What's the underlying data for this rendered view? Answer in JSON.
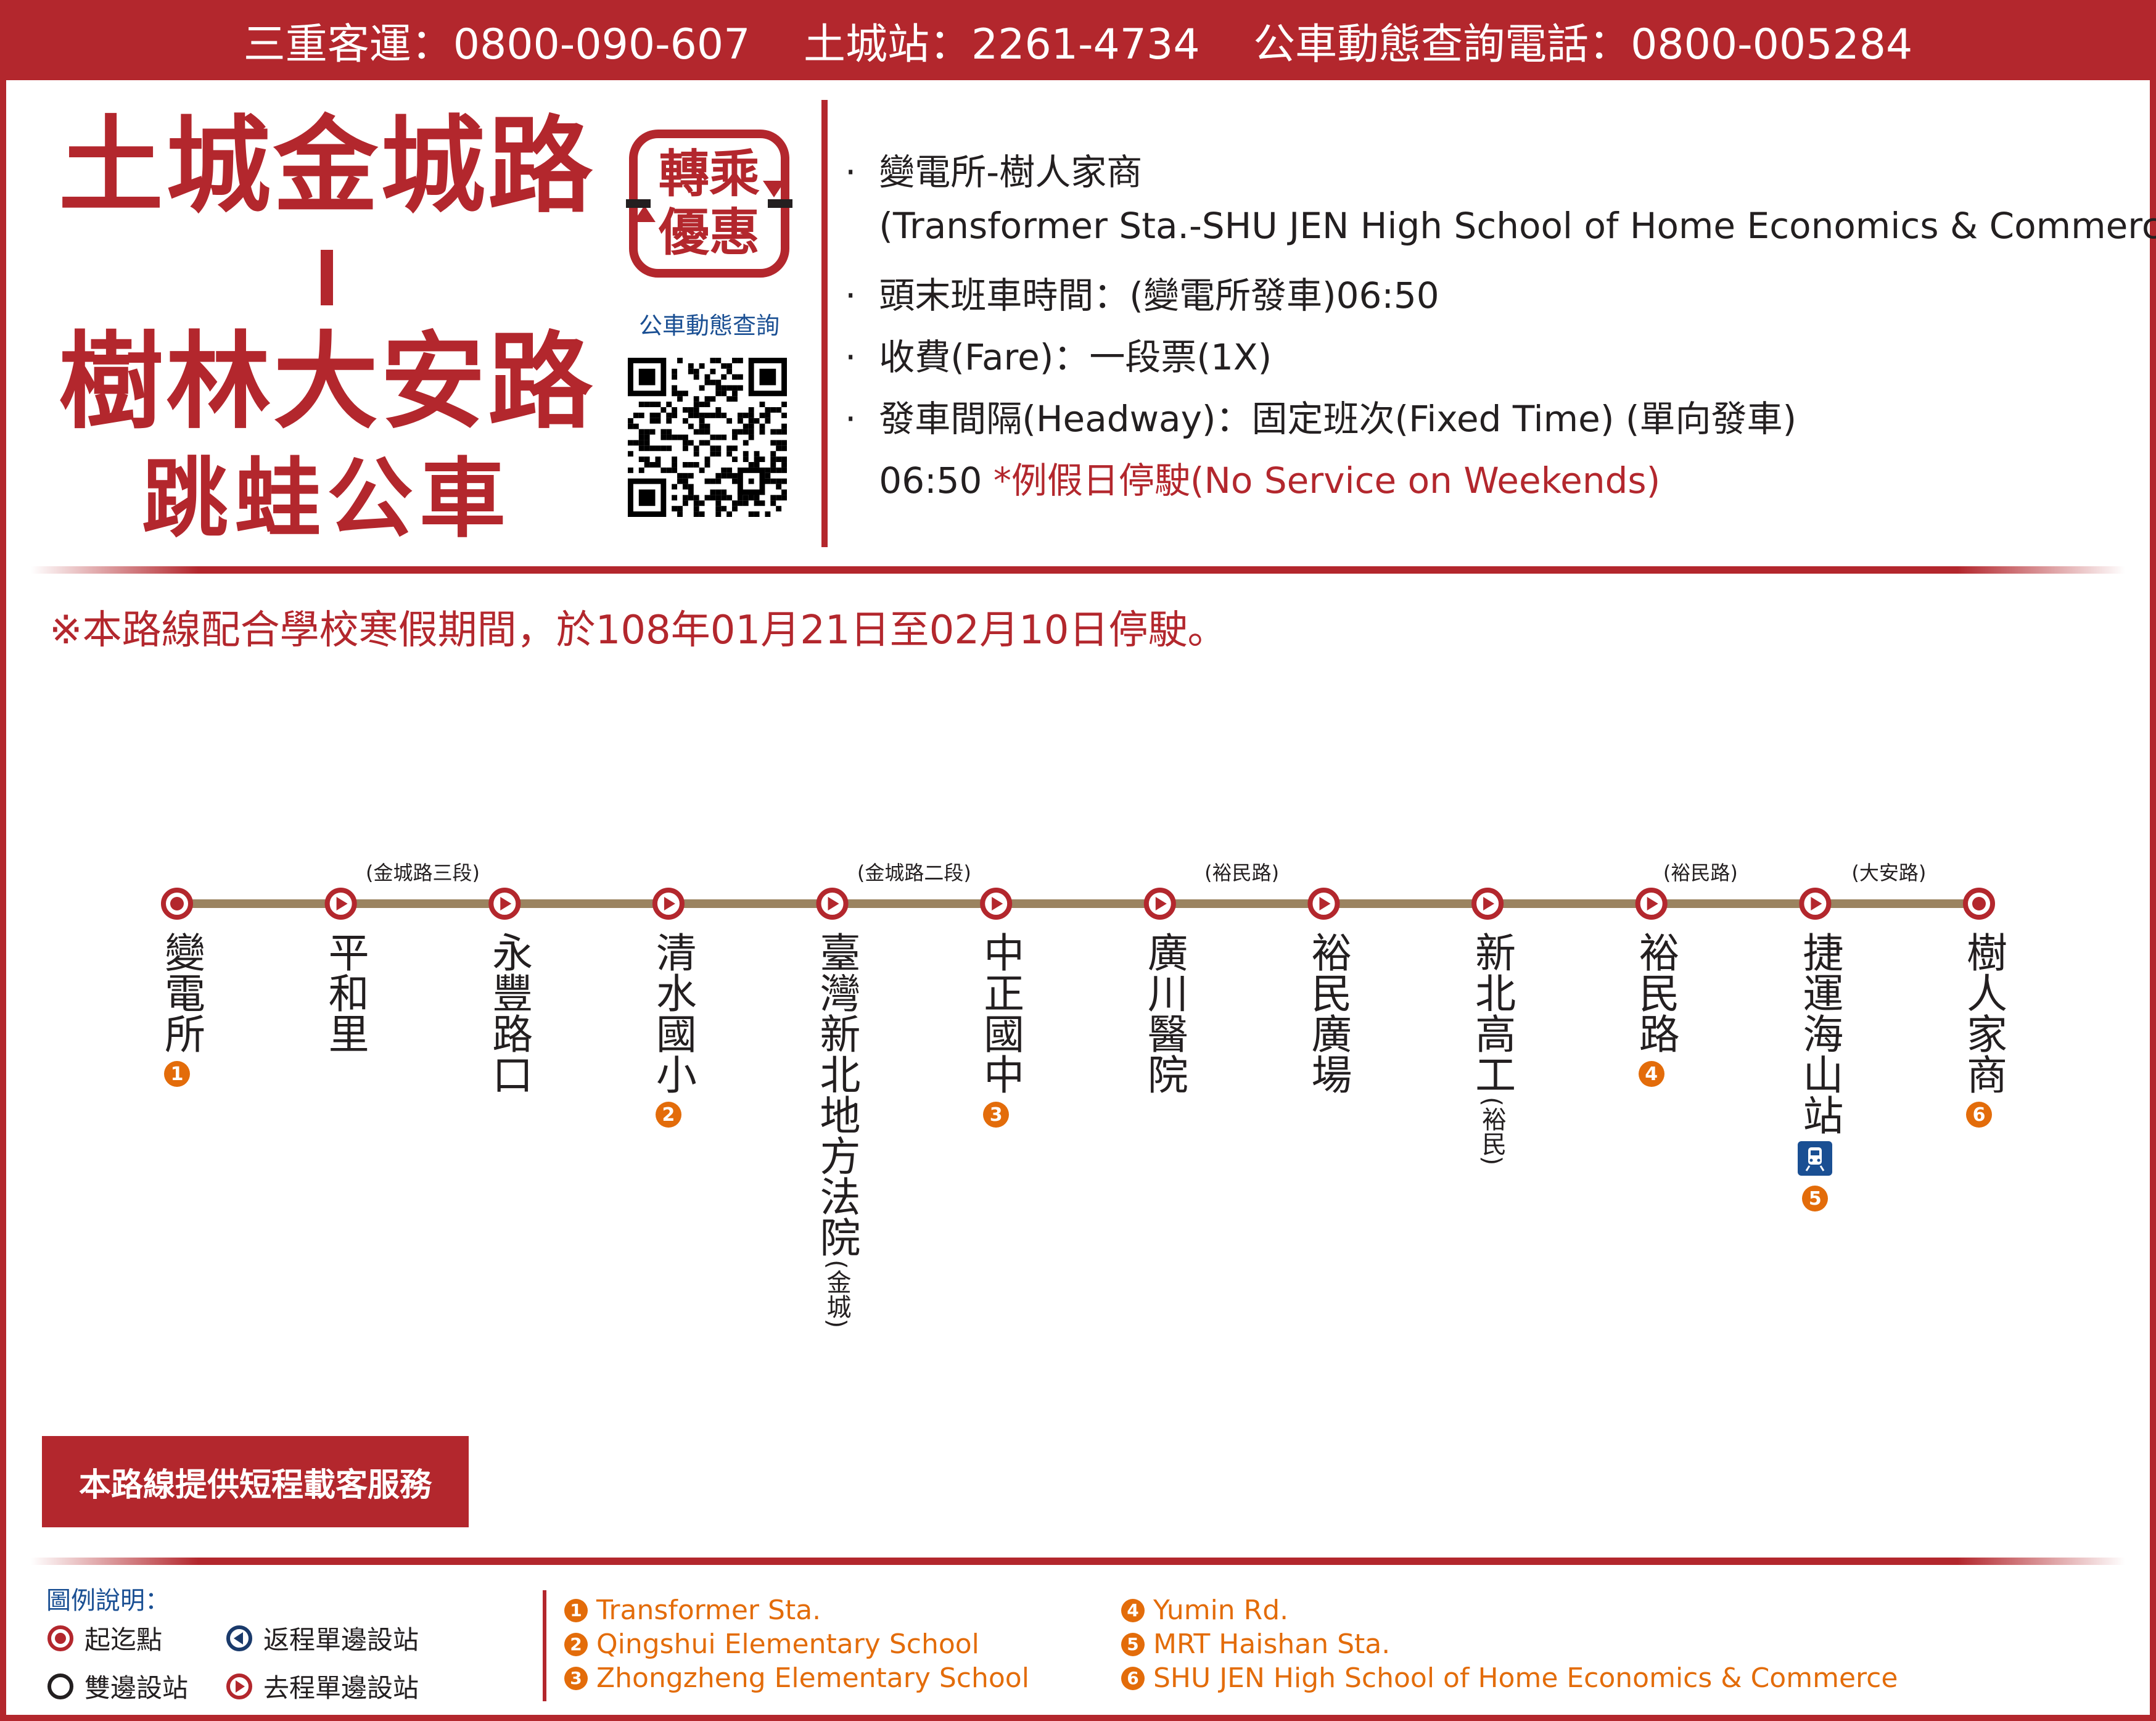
{
  "header": {
    "hotline_company": "三重客運：0800-090-607",
    "hotline_station": "土城站：2261-4734",
    "hotline_query": "公車動態查詢電話：0800-005284"
  },
  "title": {
    "line1": "土城金城路",
    "line2": "樹林大安路",
    "line3": "跳蛙公車"
  },
  "badge": {
    "line1": "轉乘",
    "line2": "優惠"
  },
  "qr": {
    "caption": "公車動態查詢"
  },
  "info": {
    "route_name": "·  變電所-樹人家商",
    "route_name_en": "   (Transformer Sta.-SHU JEN High School of Home Economics & Commerce)",
    "first_last": "·  頭末班車時間：(變電所發車)06:50",
    "fare": "·  收費(Fare)：一段票(1X)",
    "headway": "·  發車間隔(Headway)：固定班次(Fixed Time) (單向發車)",
    "time": "   06:50",
    "weekend_note": " *例假日停駛(No Service on Weekends)"
  },
  "notice": "※本路線配合學校寒假期間，於108年01月21日至02月10日停駛。",
  "route": {
    "line_color": "#9b8360",
    "accent_color": "#b3272d",
    "road_labels": [
      "(金城路三段)",
      "(金城路二段)",
      "(裕民路)",
      "(裕民路)",
      "(大安路)"
    ],
    "stops": [
      {
        "name": "變電所",
        "sub": "",
        "num": "1",
        "type": "terminal"
      },
      {
        "name": "平和里",
        "sub": "",
        "num": "",
        "type": "outbound"
      },
      {
        "name": "永豐路口",
        "sub": "",
        "num": "",
        "type": "outbound"
      },
      {
        "name": "清水國小",
        "sub": "",
        "num": "2",
        "type": "outbound"
      },
      {
        "name": "臺灣新北地方法院",
        "sub": "(金城)",
        "num": "",
        "type": "outbound"
      },
      {
        "name": "中正國中",
        "sub": "",
        "num": "3",
        "type": "outbound"
      },
      {
        "name": "廣川醫院",
        "sub": "",
        "num": "",
        "type": "outbound"
      },
      {
        "name": "裕民廣場",
        "sub": "",
        "num": "",
        "type": "outbound"
      },
      {
        "name": "新北高工",
        "sub": "(裕民)",
        "num": "",
        "type": "outbound"
      },
      {
        "name": "裕民路",
        "sub": "",
        "num": "4",
        "type": "outbound"
      },
      {
        "name": "捷運海山站",
        "sub": "",
        "num": "5",
        "type": "outbound",
        "mrt": true
      },
      {
        "name": "樹人家商",
        "sub": "",
        "num": "6",
        "type": "terminal"
      }
    ]
  },
  "service_button": "本路線提供短程載客服務",
  "legend": {
    "title": "圖例說明：",
    "terminal": "起迄點",
    "both_sides": "雙邊設站",
    "return_one_side": "返程單邊設站",
    "outbound_one_side": "去程單邊設站"
  },
  "poi": [
    {
      "num": "1",
      "name": "Transformer Sta."
    },
    {
      "num": "2",
      "name": "Qingshui Elementary School"
    },
    {
      "num": "3",
      "name": "Zhongzheng Elementary School"
    },
    {
      "num": "4",
      "name": "Yumin Rd."
    },
    {
      "num": "5",
      "name": "MRT Haishan Sta."
    },
    {
      "num": "6",
      "name": "SHU JEN High School of Home Economics & Commerce"
    }
  ]
}
